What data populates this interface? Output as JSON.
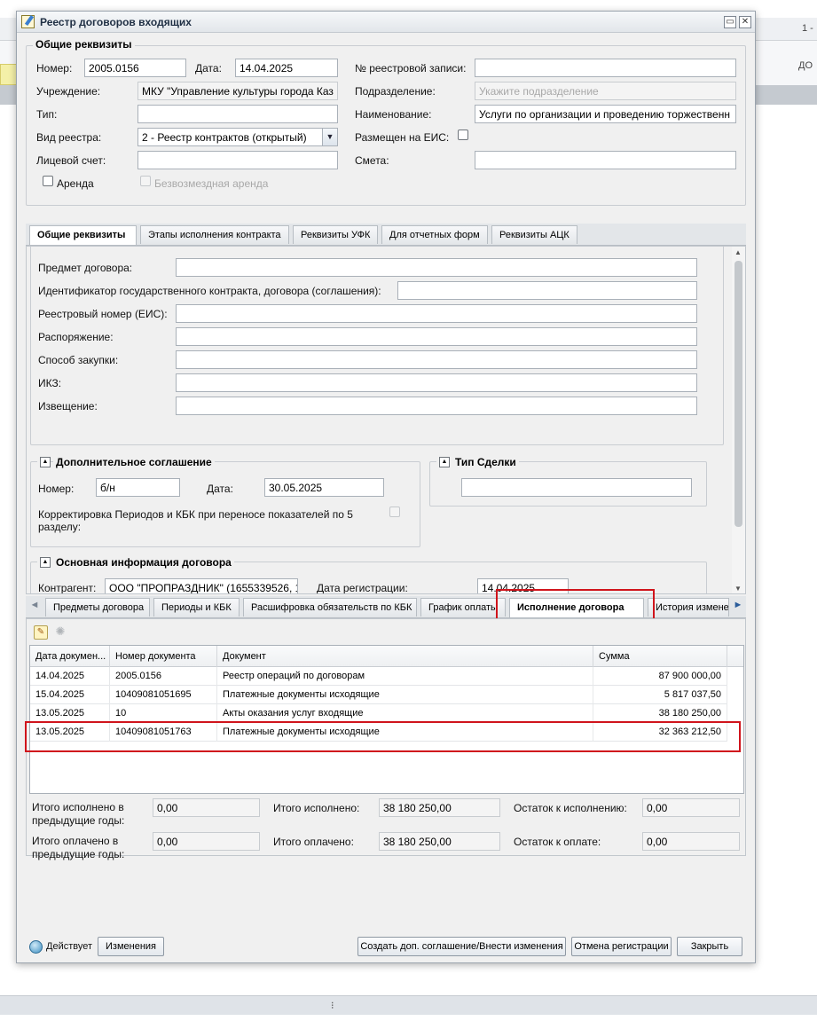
{
  "background": {
    "top_right_text": "1 -",
    "right_col_text": "ДО",
    "bottom_text": "⁝"
  },
  "window": {
    "title": "Реестр договоров входящих",
    "maximize_icon": "maximize-icon",
    "close_icon": "close-icon"
  },
  "general": {
    "legend": "Общие реквизиты",
    "number_label": "Номер:",
    "number_value": "2005.0156",
    "date_label": "Дата:",
    "date_value": "14.04.2025",
    "registry_record_label": "№ реестровой записи:",
    "registry_record_value": "",
    "institution_label": "Учреждение:",
    "institution_value": "МКУ \"Управление культуры города Каз",
    "subdivision_label": "Подразделение:",
    "subdivision_placeholder": "Укажите подразделение",
    "type_label": "Тип:",
    "type_value": "",
    "name_label": "Наименование:",
    "name_value": "Услуги по организации и проведению торжественн",
    "registry_kind_label": "Вид реестра:",
    "registry_kind_value": "2 - Реестр контрактов (открытый)",
    "eis_label": "Размещен на ЕИС:",
    "account_label": "Лицевой счет:",
    "account_value": "",
    "estimate_label": "Смета:",
    "estimate_value": "",
    "rent_label": "Аренда",
    "free_rent_label": "Безвозмездная аренда"
  },
  "top_tabs": [
    "Общие реквизиты",
    "Этапы исполнения контракта",
    "Реквизиты УФК",
    "Для отчетных форм",
    "Реквизиты АЦК"
  ],
  "details": {
    "subject_label": "Предмет договора:",
    "contract_id_label": "Идентификатор государственного контракта, договора (соглашения):",
    "eis_number_label": "Реестровый номер (ЕИС):",
    "order_label": "Распоряжение:",
    "purchase_method_label": "Способ закупки:",
    "ikz_label": "ИКЗ:",
    "notice_label": "Извещение:"
  },
  "supplementary": {
    "legend": "Дополнительное соглашение",
    "number_label": "Номер:",
    "number_value": "б/н",
    "date_label": "Дата:",
    "date_value": "30.05.2025",
    "correction_label": "Корректировка Периодов и КБК при переносе показателей по 5 разделу:"
  },
  "deal_type": {
    "legend": "Тип Сделки",
    "value": ""
  },
  "main_info": {
    "legend": "Основная информация договора",
    "counterparty_label": "Контрагент:",
    "counterparty_value": "ООО \"ПРОПРАЗДНИК\" (1655339526, 1(",
    "reg_date_label": "Дата регистрации:",
    "reg_date_value": "14.04.2025"
  },
  "bottom_tabs": [
    "Предметы договора",
    "Периоды и КБК",
    "Расшифровка обязательств по КБК",
    "График оплаты",
    "Исполнение договора",
    "История изменени"
  ],
  "grid": {
    "columns": [
      "Дата докумен...",
      "Номер документа",
      "Документ",
      "Сумма"
    ],
    "rows": [
      [
        "14.04.2025",
        "2005.0156",
        "Реестр операций по договорам",
        "87 900 000,00"
      ],
      [
        "15.04.2025",
        "10409081051695",
        "Платежные документы исходящие",
        "5 817 037,50"
      ],
      [
        "13.05.2025",
        "10",
        "Акты оказания услуг входящие",
        "38 180 250,00"
      ],
      [
        "13.05.2025",
        "10409081051763",
        "Платежные документы исходящие",
        "32 363 212,50"
      ]
    ]
  },
  "totals": {
    "prev_executed_label": "Итого исполнено в предыдущие годы:",
    "prev_executed_value": "0,00",
    "executed_label": "Итого исполнено:",
    "executed_value": "38 180 250,00",
    "remain_exec_label": "Остаток к исполнению:",
    "remain_exec_value": "0,00",
    "prev_paid_label": "Итого оплачено в предыдущие годы:",
    "prev_paid_value": "0,00",
    "paid_label": "Итого оплачено:",
    "paid_value": "38 180 250,00",
    "remain_pay_label": "Остаток к оплате:",
    "remain_pay_value": "0,00"
  },
  "footer": {
    "status_label": "Действует",
    "changes_button": "Изменения",
    "create_supp_button": "Создать доп. соглашение/Внести изменения",
    "cancel_reg_button": "Отмена регистрации",
    "close_button": "Закрыть"
  },
  "colors": {
    "highlight": "#d0141c",
    "window_bg": "#f0f0f0"
  }
}
